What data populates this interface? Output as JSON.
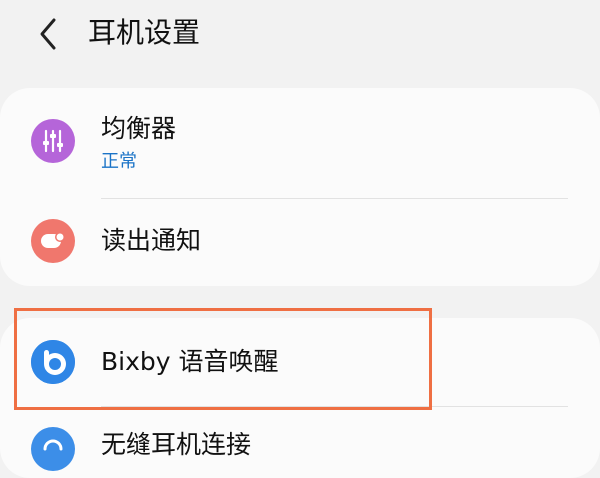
{
  "header": {
    "title": "耳机设置"
  },
  "settings": {
    "equalizer": {
      "label": "均衡器",
      "value": "正常"
    },
    "read_notifications": {
      "label": "读出通知"
    },
    "bixby_wake": {
      "label": "Bixby 语音唤醒"
    },
    "seamless_connect": {
      "label": "无缝耳机连接"
    }
  },
  "colors": {
    "equalizer_icon": "#b565d9",
    "notifications_icon": "#f0776d",
    "bixby_icon": "#2f86e6",
    "highlight": "#ef6f43",
    "sublabel": "#1a73c7"
  },
  "icons": {
    "back": "chevron-left-icon",
    "equalizer": "equalizer-sliders-icon",
    "read_notifications": "notification-bubble-icon",
    "bixby": "bixby-icon",
    "seamless_connect": "seamless-connect-icon"
  }
}
